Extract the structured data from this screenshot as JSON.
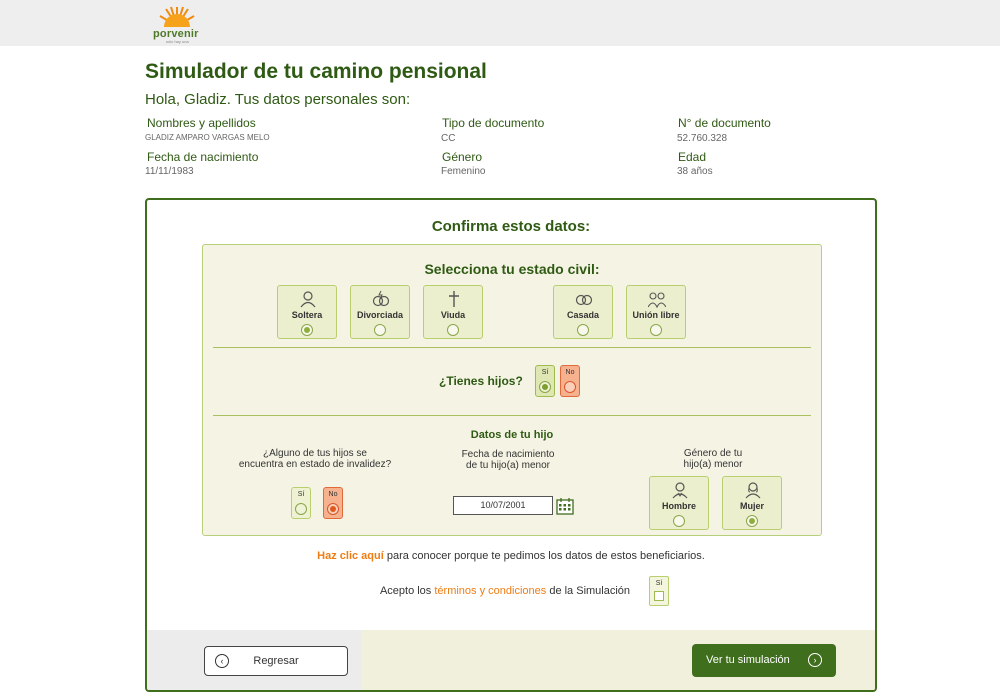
{
  "brand": {
    "name": "porvenir",
    "tagline": "sólo hay una"
  },
  "page": {
    "title": "Simulador de tu camino pensional",
    "greeting": "Hola, Gladiz. Tus datos personales son:"
  },
  "personal": {
    "name_label": "Nombres y apellidos",
    "name_value": "GLADIZ AMPARO VARGAS MELO",
    "doctype_label": "Tipo de documento",
    "doctype_value": "CC",
    "docnum_label": "N° de documento",
    "docnum_value": "52.760.328",
    "birth_label": "Fecha de nacimiento",
    "birth_value": "11/11/1983",
    "gender_label": "Género",
    "gender_value": "Femenino",
    "age_label": "Edad",
    "age_value": "38 años"
  },
  "confirm": {
    "title": "Confirma estos datos:"
  },
  "civil": {
    "title": "Selecciona tu estado civil:",
    "options": [
      {
        "label": "Soltera",
        "icon": "person-icon",
        "selected": true
      },
      {
        "label": "Divorciada",
        "icon": "broken-rings-icon",
        "selected": false
      },
      {
        "label": "Viuda",
        "icon": "cross-icon",
        "selected": false
      },
      {
        "label": "Casada",
        "icon": "rings-icon",
        "selected": false
      },
      {
        "label": "Unión libre",
        "icon": "couple-icon",
        "selected": false
      }
    ]
  },
  "children": {
    "question": "¿Tienes hijos?",
    "yes": "Sí",
    "no": "No",
    "answer": "Sí"
  },
  "child": {
    "title": "Datos de tu hijo",
    "invalid_q1": "¿Alguno de tus hijos se",
    "invalid_q2": "encuentra en estado de invalidez?",
    "invalid_yes": "Sí",
    "invalid_no": "No",
    "invalid_answer": "No",
    "birth_q1": "Fecha de nacimiento",
    "birth_q2": "de tu hijo(a) menor",
    "birth_value": "10/07/2001",
    "gender_q1": "Género de tu",
    "gender_q2": "hijo(a) menor",
    "gender_male": "Hombre",
    "gender_female": "Mujer",
    "gender_answer": "Mujer"
  },
  "info": {
    "link": "Haz clic aquí",
    "text": " para conocer porque te pedimos los datos de estos beneficiarios."
  },
  "terms": {
    "pre": "Acepto los ",
    "link1": "términos",
    "mid": " y ",
    "link2": "condiciones",
    "post": " de la Simulación",
    "box_label": "Sí"
  },
  "footer": {
    "back": "Regresar",
    "next": "Ver tu simulación"
  },
  "colors": {
    "primary": "#3f6e1d",
    "accent": "#ef7d14",
    "panel": "#f5f4e4"
  }
}
